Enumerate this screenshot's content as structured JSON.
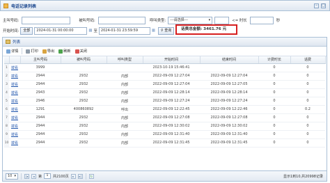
{
  "window": {
    "title": "电话记录列表"
  },
  "filters": {
    "caller_label": "主叫号码:",
    "callee_label": "被叫号码:",
    "call_type_label": "呼叫类型:",
    "call_type_value": "---请选择---",
    "duration_op": "<= 时长",
    "duration_unit": "秒",
    "start_label": "开始时间:",
    "all_button": "全部",
    "start_from": "2024-01-31 00:00:00",
    "to": "至",
    "start_to": "2024-01-31 23:59:59",
    "query_button": "查询"
  },
  "summary": {
    "label": "话费总金额:",
    "amount": "3461.76",
    "unit": "元"
  },
  "panel": {
    "title": "列表"
  },
  "toolbar": {
    "detail": "详情",
    "print": "打印",
    "export": "导出",
    "refresh": "刷新",
    "close": "关闭"
  },
  "table": {
    "columns": [
      "主叫号码",
      "被叫号码",
      "呼叫类型",
      "开始时间",
      "结束时间",
      "计费时长",
      "话费"
    ],
    "rows": [
      {
        "op": "拨看",
        "caller": "3999",
        "callee": "",
        "type": "",
        "start": "2023-10-19 15:46:41",
        "end": "",
        "billing": "0",
        "fee": "0"
      },
      {
        "op": "拨看",
        "caller": "2944",
        "callee": "2932",
        "type": "内部",
        "start": "2022-09-09 12:27:04",
        "end": "2022-09-09 12:27:04",
        "billing": "0",
        "fee": "0"
      },
      {
        "op": "拨看",
        "caller": "2944",
        "callee": "2932",
        "type": "内部",
        "start": "2022-09-09 12:27:04",
        "end": "2022-09-09 12:27:05",
        "billing": "0",
        "fee": "0"
      },
      {
        "op": "拨看",
        "caller": "2943",
        "callee": "2932",
        "type": "内部",
        "start": "2022-09-09 12:28:14",
        "end": "2022-09-09 12:28:14",
        "billing": "0",
        "fee": "0"
      },
      {
        "op": "拨看",
        "caller": "2946",
        "callee": "2932",
        "type": "内部",
        "start": "2022-09-09 12:27:24",
        "end": "2022-09-09 12:27:24",
        "billing": "0",
        "fee": "0"
      },
      {
        "op": "拨看",
        "caller": "1291",
        "callee": "400860892",
        "type": "呼出",
        "start": "2022-09-09 12:22:45",
        "end": "2022-09-09 12:22:46",
        "billing": "0",
        "fee": "0.2"
      },
      {
        "op": "拨看",
        "caller": "2944",
        "callee": "2932",
        "type": "内部",
        "start": "2022-09-09 12:27:08",
        "end": "2022-09-09 12:27:08",
        "billing": "0",
        "fee": "0"
      },
      {
        "op": "拨看",
        "caller": "2944",
        "callee": "2932",
        "type": "内部",
        "start": "2022-09-09 12:30:02",
        "end": "2022-09-09 12:30:02",
        "billing": "0",
        "fee": "0"
      },
      {
        "op": "拨看",
        "caller": "2944",
        "callee": "2932",
        "type": "内部",
        "start": "2022-09-09 12:31:40",
        "end": "2022-09-09 12:31:40",
        "billing": "0",
        "fee": "0"
      },
      {
        "op": "拨看",
        "caller": "2944",
        "callee": "2932",
        "type": "内部",
        "start": "2022-09-09 12:31:45",
        "end": "2022-09-09 12:31:45",
        "billing": "0",
        "fee": "0"
      }
    ]
  },
  "pager": {
    "page_size": "10",
    "page_label": "第",
    "page_value": "1",
    "page_total": "共2100页",
    "summary": "显示1到10,共20998记录"
  },
  "colors": {
    "accent": "#15428b",
    "highlight_border": "#d61f1f",
    "link": "#2a5db0"
  }
}
